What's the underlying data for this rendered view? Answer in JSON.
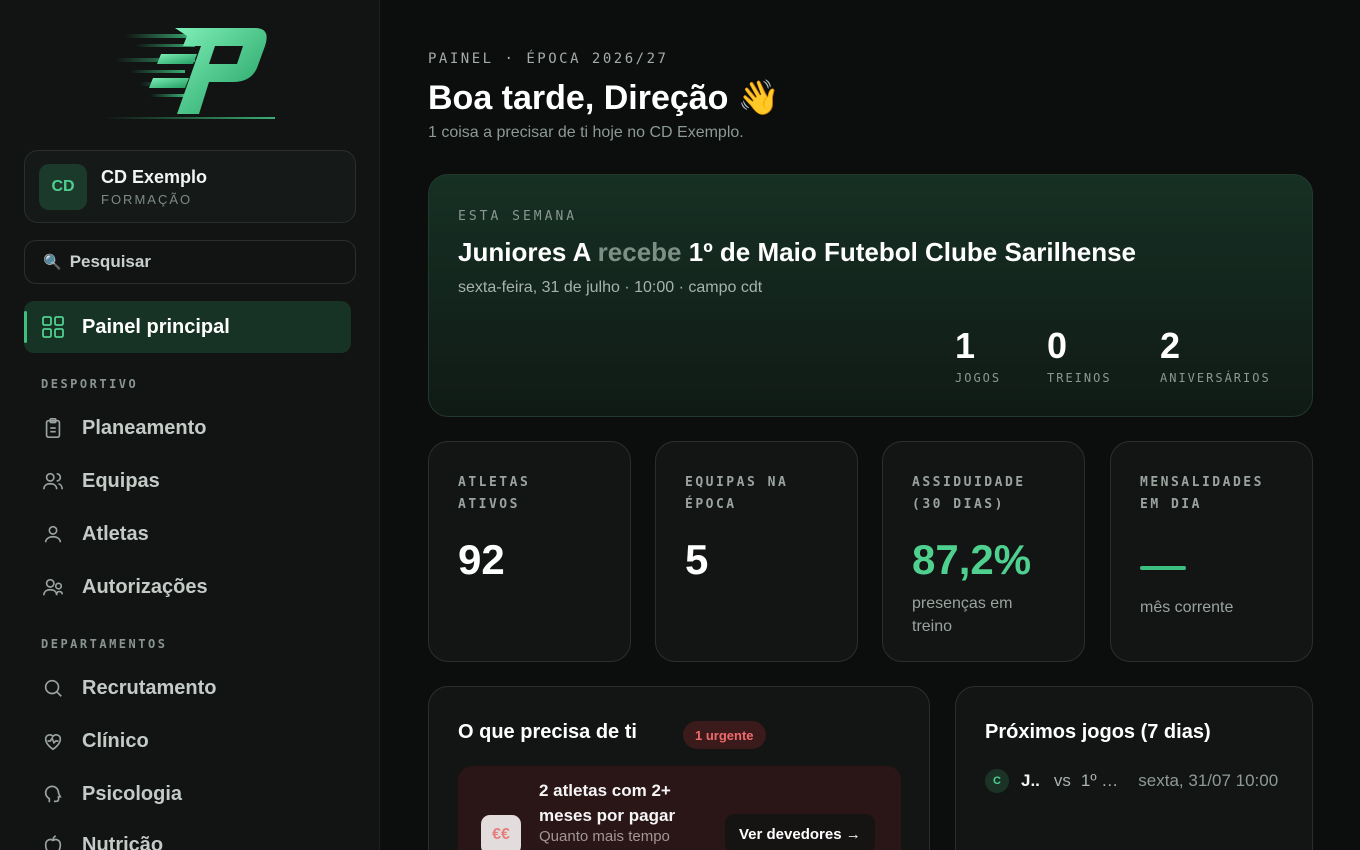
{
  "org": {
    "initials": "CD",
    "name": "CD Exemplo",
    "subtitle": "FORMAÇÃO"
  },
  "search": {
    "label": "Pesquisar",
    "icon": "search-icon"
  },
  "nav": {
    "active": {
      "label": "Painel principal",
      "icon": "grid-icon"
    },
    "sections": [
      {
        "title": "DESPORTIVO",
        "items": [
          {
            "label": "Planeamento",
            "icon": "clipboard-icon"
          },
          {
            "label": "Equipas",
            "icon": "users-icon"
          },
          {
            "label": "Atletas",
            "icon": "user-icon"
          },
          {
            "label": "Autorizações",
            "icon": "user-check-icon"
          }
        ]
      },
      {
        "title": "DEPARTAMENTOS",
        "items": [
          {
            "label": "Recrutamento",
            "icon": "search-icon"
          },
          {
            "label": "Clínico",
            "icon": "heart-pulse-icon"
          },
          {
            "label": "Psicologia",
            "icon": "head-icon"
          },
          {
            "label": "Nutrição",
            "icon": "apple-icon"
          }
        ]
      }
    ]
  },
  "header": {
    "eyebrow": "PAINEL · ÉPOCA 2026/27",
    "greeting": "Boa tarde, Direção 👋",
    "subtitle": "1 coisa a precisar de ti hoje no CD Exemplo."
  },
  "week": {
    "eyebrow": "ESTA SEMANA",
    "home": "Juniores A",
    "verb": "recebe",
    "away": "1º de Maio Futebol Clube Sarilhense",
    "meta": "sexta-feira, 31 de julho · 10:00 · campo cdt",
    "stats": [
      {
        "value": "1",
        "label": "JOGOS"
      },
      {
        "value": "0",
        "label": "TREINOS"
      },
      {
        "value": "2",
        "label": "ANIVERSÁRIOS"
      }
    ]
  },
  "kpis": [
    {
      "label_l1": "ATLETAS",
      "label_l2": "ATIVOS",
      "value": "92",
      "sub": ""
    },
    {
      "label_l1": "EQUIPAS NA",
      "label_l2": "ÉPOCA",
      "value": "5",
      "sub": ""
    },
    {
      "label_l1": "ASSIDUIDADE",
      "label_l2": "(30 DIAS)",
      "value": "87,2%",
      "sub": "presenças em treino"
    },
    {
      "label_l1": "MENSALIDADES",
      "label_l2": "EM DIA",
      "value": "—",
      "sub": "mês corrente"
    }
  ],
  "tasks": {
    "title": "O que precisa de ti",
    "badge": "1 urgente",
    "item": {
      "icon": "€€",
      "title": "2 atletas com 2+ meses por pagar",
      "desc": "Quanto mais tempo",
      "button": "Ver devedores →"
    }
  },
  "games": {
    "title": "Próximos jogos (7 dias)",
    "items": [
      {
        "badge": "C",
        "home": "J..",
        "vs": "vs",
        "away": "1º …",
        "date": "sexta, 31/07 10:00"
      }
    ]
  },
  "colors": {
    "accent": "#3fbf7f",
    "accent_text": "#4fd08f",
    "urgent": "#ee6b6b",
    "background": "#0c0d0d"
  }
}
